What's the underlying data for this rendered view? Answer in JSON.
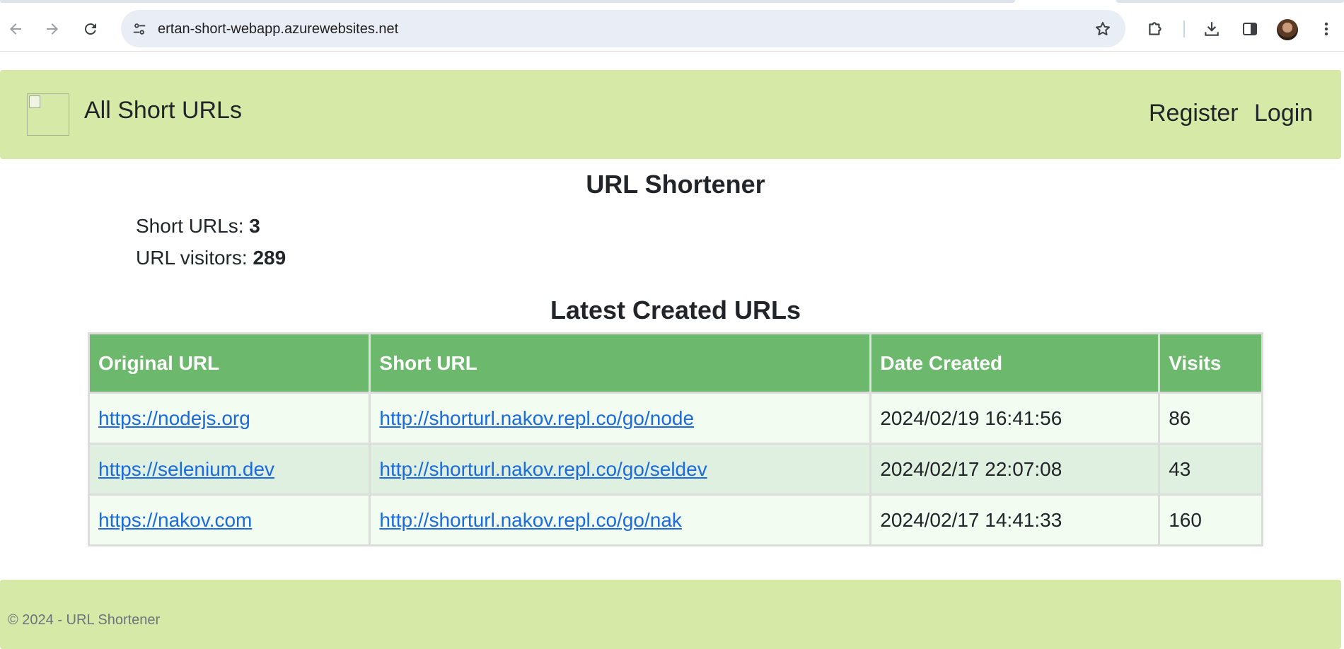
{
  "browser": {
    "url": "ertan-short-webapp.azurewebsites.net",
    "icons": [
      "back-arrow-icon",
      "forward-arrow-icon",
      "reload-icon",
      "site-settings-icon",
      "bookmark-star-icon",
      "extensions-icon",
      "download-icon",
      "side-panel-icon",
      "profile-avatar",
      "more-menu-icon"
    ]
  },
  "header": {
    "brand": "All Short URLs",
    "register": "Register",
    "login": "Login"
  },
  "main": {
    "title": "URL Shortener",
    "stats": {
      "short_urls_label": "Short URLs:",
      "short_urls_value": "3",
      "visitors_label": "URL visitors:",
      "visitors_value": "289"
    },
    "table_title": "Latest Created URLs",
    "columns": [
      "Original URL",
      "Short URL",
      "Date Created",
      "Visits"
    ],
    "rows": [
      {
        "original": "https://nodejs.org",
        "short": "http://shorturl.nakov.repl.co/go/node",
        "date": "2024/02/19 16:41:56",
        "visits": "86"
      },
      {
        "original": "https://selenium.dev",
        "short": "http://shorturl.nakov.repl.co/go/seldev",
        "date": "2024/02/17 22:07:08",
        "visits": "43"
      },
      {
        "original": "https://nakov.com",
        "short": "http://shorturl.nakov.repl.co/go/nak",
        "date": "2024/02/17 14:41:33",
        "visits": "160"
      }
    ]
  },
  "footer": {
    "text": "© 2024 - URL Shortener"
  },
  "colors": {
    "header_bg": "#d6e9a6",
    "table_header_bg": "#6cb86c",
    "row_odd_bg": "#f2fcf0",
    "row_even_bg": "#e0f0e0",
    "link": "#1a6be0"
  }
}
